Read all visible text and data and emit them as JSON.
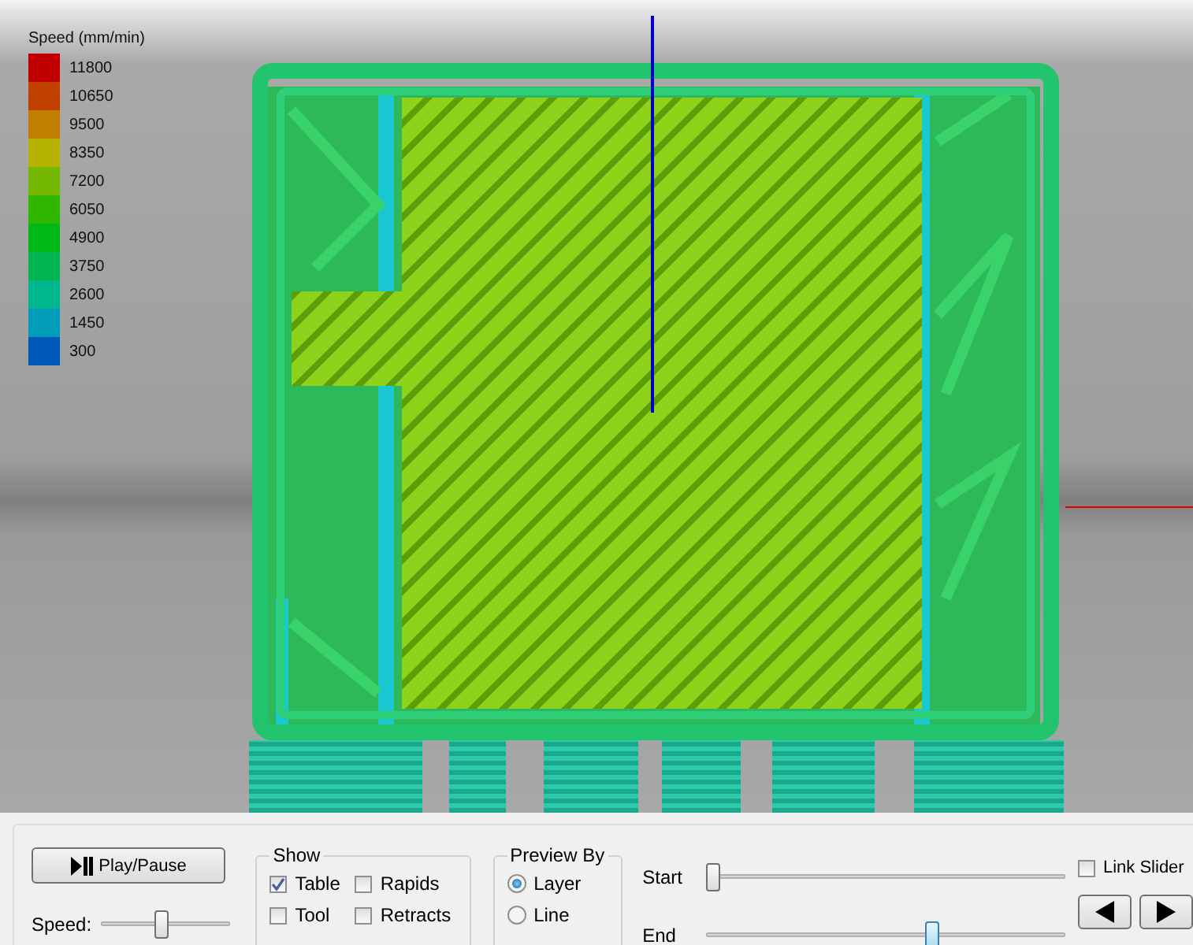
{
  "legend": {
    "title": "Speed (mm/min)",
    "entries": [
      {
        "label": "11800",
        "color": "#c00000"
      },
      {
        "label": "10650",
        "color": "#c04000"
      },
      {
        "label": "9500",
        "color": "#bf7f00"
      },
      {
        "label": "8350",
        "color": "#b4b400"
      },
      {
        "label": "7200",
        "color": "#74b800"
      },
      {
        "label": "6050",
        "color": "#30b800"
      },
      {
        "label": "4900",
        "color": "#00b818"
      },
      {
        "label": "3750",
        "color": "#00b450"
      },
      {
        "label": "2600",
        "color": "#00b890"
      },
      {
        "label": "1450",
        "color": "#009cb8"
      },
      {
        "label": "300",
        "color": "#0058b8"
      }
    ]
  },
  "controls": {
    "play_button": "Play/Pause",
    "speed": {
      "label": "Speed:",
      "level": 0.48
    },
    "show": {
      "title": "Show",
      "options": [
        {
          "label": "Table",
          "checked": true
        },
        {
          "label": "Rapids",
          "checked": false
        },
        {
          "label": "Tool",
          "checked": false
        },
        {
          "label": "Retracts",
          "checked": false
        }
      ]
    },
    "preview_by": {
      "title": "Preview By",
      "options": [
        {
          "label": "Layer",
          "selected": true
        },
        {
          "label": "Line",
          "selected": false
        }
      ]
    },
    "range": [
      {
        "label": "Start",
        "level": 0
      },
      {
        "label": "End",
        "level": 0.64
      }
    ],
    "link_sliders": {
      "label": "Link Slider",
      "checked": false
    }
  }
}
